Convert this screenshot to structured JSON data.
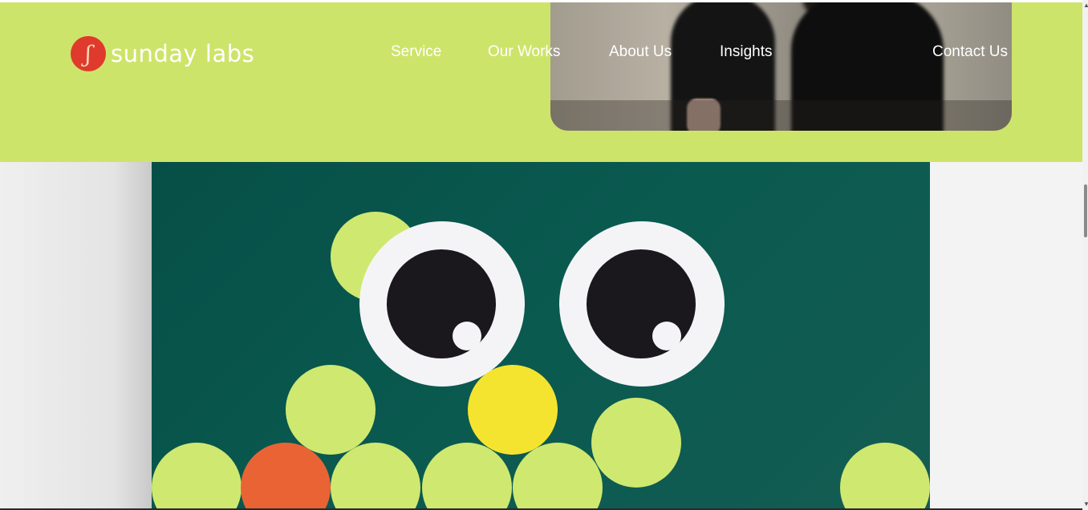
{
  "brand": {
    "name": "sunday labs",
    "mark": "ʃ",
    "accent": "#cde46a",
    "logo_red": "#e03a2c"
  },
  "nav": {
    "service": "Service",
    "our_works": "Our Works",
    "about_us": "About Us",
    "insights": "Insights",
    "contact_us": "Contact Us"
  },
  "colors": {
    "card_green": "#0a5a50",
    "lime": "#cfe870",
    "yellow": "#f5e42f",
    "orange": "#ea6334",
    "eye_white": "#f4f4f6",
    "pupil": "#1a181d"
  },
  "icons": {
    "scroll_up": "▲",
    "scroll_down": "▼"
  }
}
